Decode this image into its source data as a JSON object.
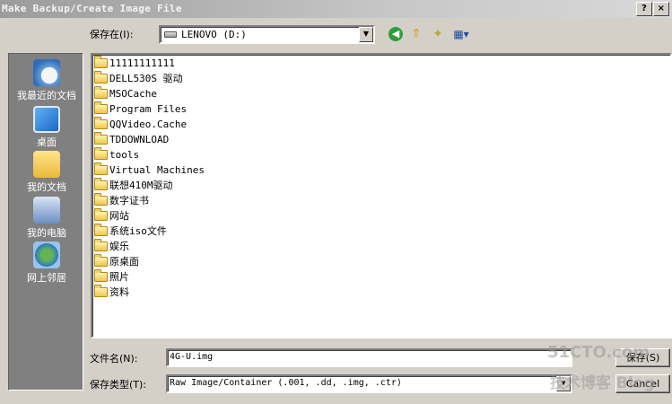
{
  "window": {
    "title": "Make Backup/Create Image File",
    "help_glyph": "?",
    "close_glyph": "×"
  },
  "toolbar": {
    "save_in_label": "保存在(I):",
    "drive": "LENOVO (D:)",
    "icons": [
      "back-icon",
      "up-folder-icon",
      "new-folder-icon",
      "views-menu-icon"
    ]
  },
  "places": [
    {
      "label": "我最近的文档",
      "icon": "recent-documents-icon"
    },
    {
      "label": "桌面",
      "icon": "desktop-icon"
    },
    {
      "label": "我的文档",
      "icon": "my-documents-icon"
    },
    {
      "label": "我的电脑",
      "icon": "my-computer-icon"
    },
    {
      "label": "网上邻居",
      "icon": "network-places-icon"
    }
  ],
  "files": [
    "11111111111",
    "DELL530S 驱动",
    "MSOCache",
    "Program Files",
    "QQVideo.Cache",
    "TDDOWNLOAD",
    "tools",
    "Virtual Machines",
    "联想410M驱动",
    "数字证书",
    "网站",
    "系统iso文件",
    "娱乐",
    "原桌面",
    "照片",
    "资料"
  ],
  "form": {
    "filename_label": "文件名(N):",
    "filename_value": "4G-U.img",
    "filetype_label": "保存类型(T):",
    "filetype_value": "Raw Image/Container (.001, .dd, .img, .ctr)",
    "save_label": "保存(S)",
    "cancel_label": "Cancel"
  },
  "watermark": {
    "line1": "51CTO.com",
    "line2": "技术博客 Blog"
  }
}
